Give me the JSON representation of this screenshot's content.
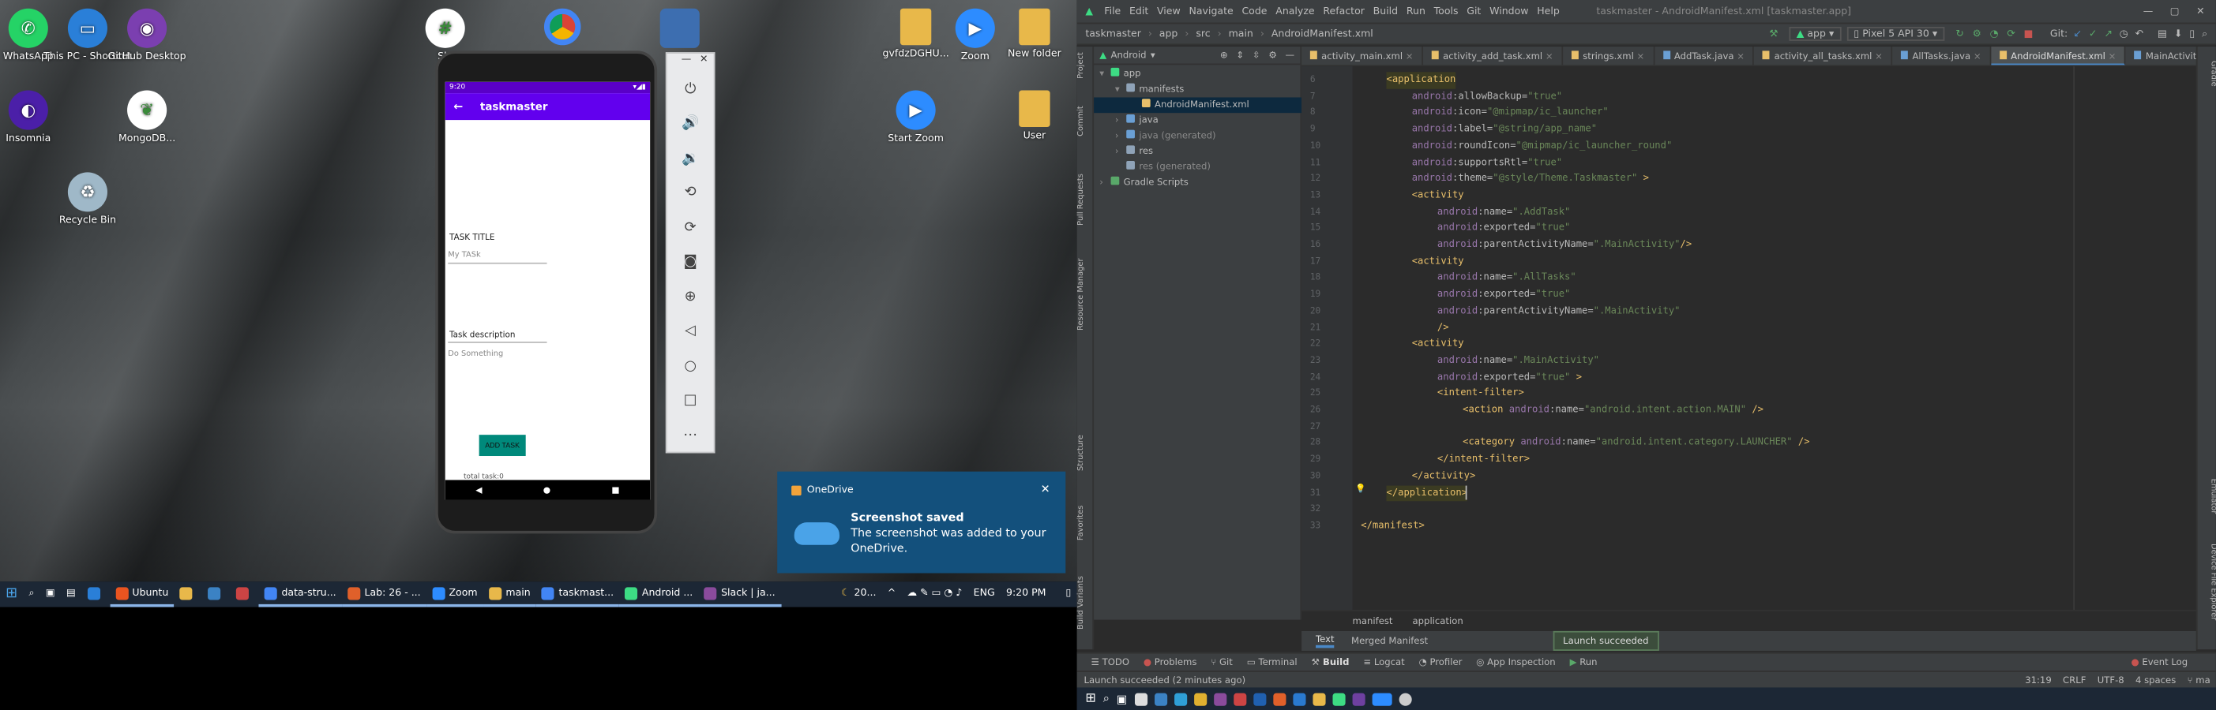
{
  "desktop": {
    "icons": [
      {
        "label": "WhatsApp",
        "color": "#25d366",
        "glyph": "✆"
      },
      {
        "label": "This PC - Shortcut",
        "color": "#2a7fd8",
        "glyph": "▭"
      },
      {
        "label": "GitHub Desktop",
        "color": "#7b3fb0",
        "glyph": "◉"
      },
      {
        "label": "Insomnia",
        "color": "#4b1fa8",
        "glyph": "◐"
      },
      {
        "label": "MongoDB...",
        "color": "#ffffff",
        "glyph": "❦"
      },
      {
        "label": "Recycle Bin",
        "color": "#9fb8c8",
        "glyph": "♻"
      },
      {
        "label": "Sla",
        "color": "#ffffff",
        "glyph": "#"
      },
      {
        "label": "gvfdzDGHU...",
        "color": "#e8b84a",
        "glyph": ""
      },
      {
        "label": "Zoom",
        "color": "#2d8cff",
        "glyph": "▶"
      },
      {
        "label": "New folder",
        "color": "#e8b84a",
        "glyph": ""
      },
      {
        "label": "Start Zoom",
        "color": "#2d8cff",
        "glyph": "▶"
      },
      {
        "label": "User",
        "color": "#e8b84a",
        "glyph": ""
      }
    ]
  },
  "taskbar_left": {
    "items": [
      "Ubuntu",
      "data-stru...",
      "Lab: 26 - ...",
      "Zoom",
      "main",
      "taskmast...",
      "Android ...",
      "Slack | ja..."
    ],
    "weather": "20...",
    "lang": "ENG",
    "time": "9:20 PM"
  },
  "phone": {
    "status_time": "9:20",
    "app_title": "taskmaster",
    "back_arrow": "←",
    "task_title_label": "TASK TITLE",
    "task_title_value": "My TASk",
    "task_desc_label": "Task description",
    "task_desc_value": "Do Something",
    "add_button": "ADD TASK",
    "total_label": "total task:0"
  },
  "emulator_toolbar": {
    "minimize": "—",
    "close": "✕",
    "buttons": [
      "power-icon",
      "volume-up-icon",
      "volume-down-icon",
      "rotate-left-icon",
      "rotate-right-icon",
      "camera-icon",
      "zoom-icon",
      "back-icon",
      "home-icon",
      "overview-icon",
      "more-icon"
    ]
  },
  "onedrive": {
    "app": "OneDrive",
    "title": "Screenshot saved",
    "body": "The screenshot was added to your OneDrive.",
    "close": "✕"
  },
  "ide": {
    "menu": [
      "File",
      "Edit",
      "View",
      "Navigate",
      "Code",
      "Analyze",
      "Refactor",
      "Build",
      "Run",
      "Tools",
      "Git",
      "Window",
      "Help"
    ],
    "window_title": "taskmaster - AndroidManifest.xml [taskmaster.app]",
    "breadcrumbs": [
      "taskmaster",
      "app",
      "src",
      "main",
      "AndroidManifest.xml"
    ],
    "run_config": "app",
    "device": "Pixel 5 API 30",
    "git_label": "Git:",
    "project_view": "Android",
    "tree": [
      {
        "label": "app",
        "indent": 0,
        "arrow": "▾",
        "selected": false,
        "dim": false
      },
      {
        "label": "manifests",
        "indent": 1,
        "arrow": "▾",
        "selected": false,
        "dim": false
      },
      {
        "label": "AndroidManifest.xml",
        "indent": 2,
        "arrow": "",
        "selected": true,
        "dim": false
      },
      {
        "label": "java",
        "indent": 1,
        "arrow": "›",
        "selected": false,
        "dim": false
      },
      {
        "label": "java (generated)",
        "indent": 1,
        "arrow": "›",
        "selected": false,
        "dim": true
      },
      {
        "label": "res",
        "indent": 1,
        "arrow": "›",
        "selected": false,
        "dim": false
      },
      {
        "label": "res (generated)",
        "indent": 1,
        "arrow": "",
        "selected": false,
        "dim": true
      },
      {
        "label": "Gradle Scripts",
        "indent": 0,
        "arrow": "›",
        "selected": false,
        "dim": false
      }
    ],
    "tabs": [
      "activity_main.xml",
      "activity_add_task.xml",
      "strings.xml",
      "AddTask.java",
      "activity_all_tasks.xml",
      "AllTasks.java",
      "AndroidManifest.xml",
      "MainActivity.java"
    ],
    "active_tab": 6,
    "warning_count": "1",
    "code_lines": [
      {
        "n": "6",
        "indent": 1,
        "html": "<span class='br'>&lt;application</span>"
      },
      {
        "n": "7",
        "indent": 2,
        "html": "<span class='ns'>android</span><span class='at'>:allowBackup=</span><span class='sv'>\"true\"</span>"
      },
      {
        "n": "8",
        "indent": 2,
        "html": "<span class='ns'>android</span><span class='at'>:icon=</span><span class='sv'>\"@mipmap/ic_launcher\"</span>"
      },
      {
        "n": "9",
        "indent": 2,
        "html": "<span class='ns'>android</span><span class='at'>:label=</span><span class='sv'>\"@string/app_name\"</span>"
      },
      {
        "n": "10",
        "indent": 2,
        "html": "<span class='ns'>android</span><span class='at'>:roundIcon=</span><span class='sv'>\"@mipmap/ic_launcher_round\"</span>"
      },
      {
        "n": "11",
        "indent": 2,
        "html": "<span class='ns'>android</span><span class='at'>:supportsRtl=</span><span class='sv'>\"true\"</span>"
      },
      {
        "n": "12",
        "indent": 2,
        "html": "<span class='ns'>android</span><span class='at'>:theme=</span><span class='sv'>\"@style/Theme.Taskmaster\"</span><span class='tg'> &gt;</span>"
      },
      {
        "n": "13",
        "indent": 2,
        "html": "<span class='tg'>&lt;activity</span>"
      },
      {
        "n": "14",
        "indent": 3,
        "html": "<span class='ns'>android</span><span class='at'>:name=</span><span class='sv'>\".AddTask\"</span>"
      },
      {
        "n": "15",
        "indent": 3,
        "html": "<span class='ns'>android</span><span class='at'>:exported=</span><span class='sv'>\"true\"</span>"
      },
      {
        "n": "16",
        "indent": 3,
        "html": "<span class='ns'>android</span><span class='at'>:parentActivityName=</span><span class='sv'>\".MainActivity\"</span><span class='tg'>/&gt;</span>"
      },
      {
        "n": "17",
        "indent": 2,
        "html": "<span class='tg'>&lt;activity</span>"
      },
      {
        "n": "18",
        "indent": 3,
        "html": "<span class='ns'>android</span><span class='at'>:name=</span><span class='sv'>\".AllTasks\"</span>"
      },
      {
        "n": "19",
        "indent": 3,
        "html": "<span class='ns'>android</span><span class='at'>:exported=</span><span class='sv'>\"true\"</span>"
      },
      {
        "n": "20",
        "indent": 3,
        "html": "<span class='ns'>android</span><span class='at'>:parentActivityName=</span><span class='sv'>\".MainActivity\"</span>"
      },
      {
        "n": "21",
        "indent": 3,
        "html": "<span class='tg'>/&gt;</span>"
      },
      {
        "n": "22",
        "indent": 2,
        "html": "<span class='tg'>&lt;activity</span>"
      },
      {
        "n": "23",
        "indent": 3,
        "html": "<span class='ns'>android</span><span class='at'>:name=</span><span class='sv'>\".MainActivity\"</span>"
      },
      {
        "n": "24",
        "indent": 3,
        "html": "<span class='ns'>android</span><span class='at'>:exported=</span><span class='sv'>\"true\"</span><span class='tg'> &gt;</span>"
      },
      {
        "n": "25",
        "indent": 3,
        "html": "<span class='tg'>&lt;intent-filter&gt;</span>"
      },
      {
        "n": "26",
        "indent": 4,
        "html": "<span class='tg'>&lt;action </span><span class='ns'>android</span><span class='at'>:name=</span><span class='sv'>\"android.intent.action.MAIN\"</span><span class='tg'> /&gt;</span>"
      },
      {
        "n": "27",
        "indent": 4,
        "html": ""
      },
      {
        "n": "28",
        "indent": 4,
        "html": "<span class='tg'>&lt;category </span><span class='ns'>android</span><span class='at'>:name=</span><span class='sv'>\"android.intent.category.LAUNCHER\"</span><span class='tg'> /&gt;</span>"
      },
      {
        "n": "29",
        "indent": 3,
        "html": "<span class='tg'>&lt;/intent-filter&gt;</span>"
      },
      {
        "n": "30",
        "indent": 2,
        "html": "<span class='tg'>&lt;/activity&gt;</span>"
      },
      {
        "n": "31",
        "indent": 1,
        "html": "<span class='br'>&lt;/application&gt;</span>"
      },
      {
        "n": "32",
        "indent": 0,
        "html": ""
      },
      {
        "n": "33",
        "indent": 0,
        "html": "<span class='tg'>&lt;/manifest&gt;</span>"
      }
    ],
    "bottom_breadcrumbs": [
      "manifest",
      "application"
    ],
    "subtabs": [
      "Text",
      "Merged Manifest"
    ],
    "toast": "Launch succeeded",
    "tool_windows": [
      "TODO",
      "Problems",
      "Git",
      "Terminal",
      "Build",
      "Logcat",
      "Profiler",
      "App Inspection",
      "Run"
    ],
    "event_log": "Event Log",
    "status_message": "Launch succeeded (2 minutes ago)",
    "cursor_pos": "31:19",
    "line_sep": "CRLF",
    "encoding": "UTF-8",
    "indent": "4 spaces",
    "branch": "ma",
    "left_strip": [
      "Project",
      "Commit",
      "Pull Requests",
      "Resource Manager",
      "Structure",
      "Favorites",
      "Build Variants"
    ],
    "right_strip": [
      "Gradle",
      "Emulator",
      "Device File Explorer"
    ]
  }
}
